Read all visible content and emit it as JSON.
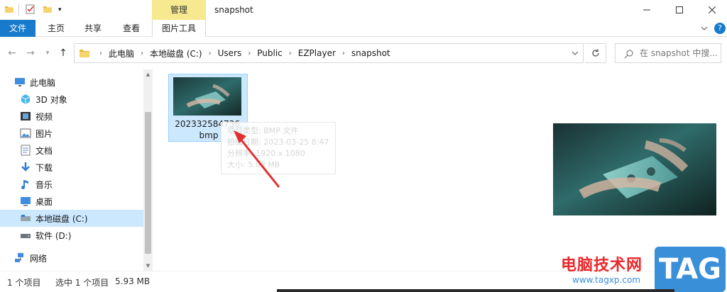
{
  "window": {
    "title": "snapshot",
    "context_tab": "管理"
  },
  "ribbon": {
    "tabs": [
      "文件",
      "主页",
      "共享",
      "查看",
      "图片工具"
    ],
    "help": "?"
  },
  "address": {
    "crumbs": [
      "此电脑",
      "本地磁盘 (C:)",
      "Users",
      "Public",
      "EZPlayer",
      "snapshot"
    ]
  },
  "search": {
    "placeholder": "在 snapshot 中搜..."
  },
  "nav": {
    "items": [
      {
        "label": "此电脑",
        "icon": "computer-icon"
      },
      {
        "label": "3D 对象",
        "icon": "cube-icon"
      },
      {
        "label": "视频",
        "icon": "video-icon"
      },
      {
        "label": "图片",
        "icon": "picture-icon"
      },
      {
        "label": "文档",
        "icon": "document-icon"
      },
      {
        "label": "下载",
        "icon": "download-icon"
      },
      {
        "label": "音乐",
        "icon": "music-icon"
      },
      {
        "label": "桌面",
        "icon": "desktop-icon"
      },
      {
        "label": "本地磁盘 (C:)",
        "icon": "drive-icon"
      },
      {
        "label": "软件 (D:)",
        "icon": "drive-icon"
      },
      {
        "label": "网络",
        "icon": "network-icon"
      }
    ]
  },
  "file": {
    "name_line1": "202332584736.",
    "name_line2": "bmp"
  },
  "tooltip": {
    "type": "项目类型: BMP 文件",
    "date": "拍摄日期: 2023-03-25 8:47",
    "dims": "分辨率: 1920 x 1080",
    "size": "大小: 5.93 MB"
  },
  "status": {
    "count": "1 个项目",
    "selected": "选中 1 个项目",
    "size": "5.93 MB"
  },
  "watermark": {
    "text": "电脑技术网",
    "url": "www.tagxp.com",
    "logo": "TAG"
  },
  "colors": {
    "accent": "#1979ca",
    "selection": "#cce8ff",
    "manage_tab": "#f6e98f",
    "arrow": "#e03030"
  }
}
